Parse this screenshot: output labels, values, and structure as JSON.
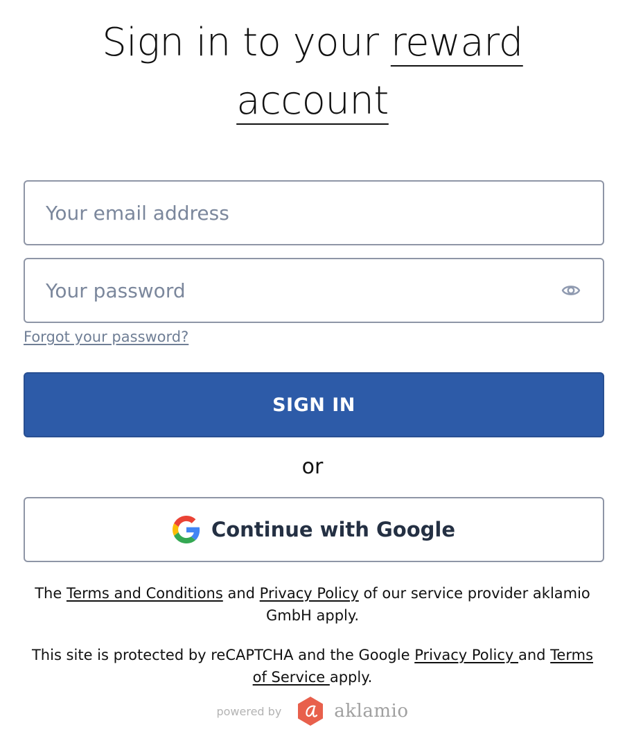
{
  "header": {
    "title_part1": "Sign in to your ",
    "title_ul1": "reward",
    "title_ul2": "account"
  },
  "form": {
    "email_placeholder": "Your email address",
    "email_value": "",
    "password_placeholder": "Your password",
    "password_value": "",
    "forgot_label": "Forgot your password?",
    "signin_label": "SIGN IN",
    "or_label": "or",
    "google_label": "Continue with Google"
  },
  "terms": {
    "t1": "The ",
    "terms_link": "Terms and Conditions",
    "t2": " and ",
    "privacy_link": "Privacy Policy",
    "t3": " of our service provider aklamio GmbH apply."
  },
  "recaptcha": {
    "t1": "This site is protected by reCAPTCHA and the Google ",
    "privacy_link": "Privacy Policy ",
    "t2": "and ",
    "tos_link": "Terms of Service ",
    "t3": "apply."
  },
  "footer": {
    "powered_by": "powered by",
    "brand": "aklamio"
  },
  "icons": {
    "password_toggle": "eye-icon",
    "google": "google-g-icon",
    "brand_logo": "aklamio-hexagon-logo"
  },
  "colors": {
    "primary_button": "#2d5ba8",
    "field_border": "#8e95a6",
    "placeholder": "#7b879c",
    "link_muted": "#6f7e95",
    "brand_logo": "#e8604c"
  }
}
